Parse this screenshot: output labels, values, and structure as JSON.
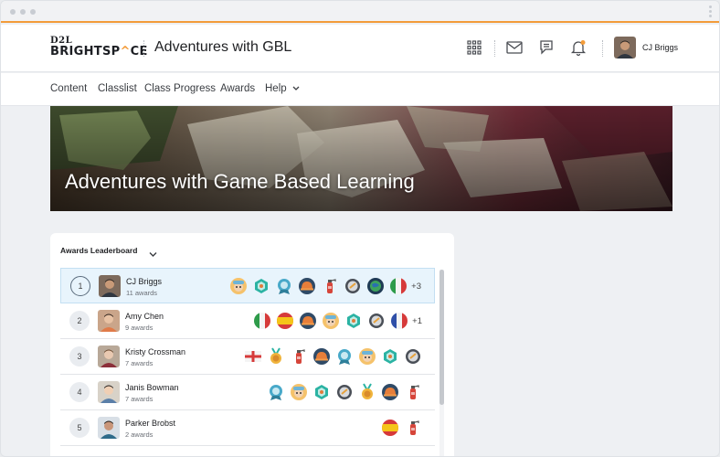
{
  "header": {
    "logo_top": "D2L",
    "logo_bottom_1": "BRIGHTSP",
    "logo_bottom_accent": "^",
    "logo_bottom_2": "CE",
    "course_title": "Adventures with GBL",
    "user_name": "CJ Briggs",
    "accent_color": "#f39c3a"
  },
  "nav": {
    "items": [
      "Content",
      "Classlist",
      "Class Progress",
      "Awards",
      "Help"
    ]
  },
  "banner": {
    "title": "Adventures with Game Based Learning"
  },
  "leaderboard": {
    "title": "Awards Leaderboard",
    "rows": [
      {
        "rank": "1",
        "name": "CJ Briggs",
        "awards": "11 awards",
        "more": "+3",
        "badges": [
          "explorer",
          "target",
          "key",
          "hardhat",
          "extinguisher",
          "shield",
          "globe",
          "italy"
        ]
      },
      {
        "rank": "2",
        "name": "Amy Chen",
        "awards": "9 awards",
        "more": "+1",
        "badges": [
          "italy",
          "spain",
          "hardhat",
          "explorer",
          "target",
          "shield",
          "france"
        ]
      },
      {
        "rank": "3",
        "name": "Kristy Crossman",
        "awards": "7 awards",
        "more": "",
        "badges": [
          "england",
          "medal",
          "extinguisher",
          "hardhat",
          "key",
          "explorer",
          "target",
          "shield"
        ]
      },
      {
        "rank": "4",
        "name": "Janis Bowman",
        "awards": "7 awards",
        "more": "",
        "badges": [
          "key",
          "explorer",
          "target",
          "shield",
          "medal",
          "hardhat",
          "extinguisher"
        ]
      },
      {
        "rank": "5",
        "name": "Parker Brobst",
        "awards": "2 awards",
        "more": "",
        "badges": [
          "spain",
          "extinguisher"
        ]
      }
    ]
  }
}
